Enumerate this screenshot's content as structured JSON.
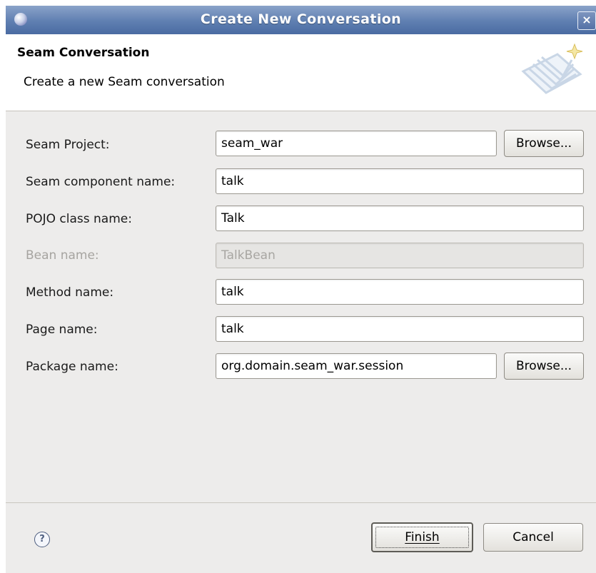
{
  "window": {
    "title": "Create New Conversation",
    "close_glyph": "×",
    "app_icon": "eclipse-icon"
  },
  "banner": {
    "title": "Seam Conversation",
    "subtitle": "Create a new Seam conversation",
    "icon": "wizard-banner-icon"
  },
  "form": {
    "seam_project": {
      "label": "Seam Project:",
      "value": "seam_war",
      "browse_label": "Browse..."
    },
    "component_name": {
      "label": "Seam component name:",
      "value": "talk"
    },
    "pojo_class": {
      "label": "POJO class name:",
      "value": "Talk"
    },
    "bean_name": {
      "label": "Bean name:",
      "value": "TalkBean",
      "disabled": true
    },
    "method_name": {
      "label": "Method name:",
      "value": "talk"
    },
    "page_name": {
      "label": "Page name:",
      "value": "talk"
    },
    "package_name": {
      "label": "Package name:",
      "value": "org.domain.seam_war.session",
      "browse_label": "Browse..."
    }
  },
  "footer": {
    "help_glyph": "?",
    "finish_label": "Finish",
    "cancel_label": "Cancel"
  }
}
